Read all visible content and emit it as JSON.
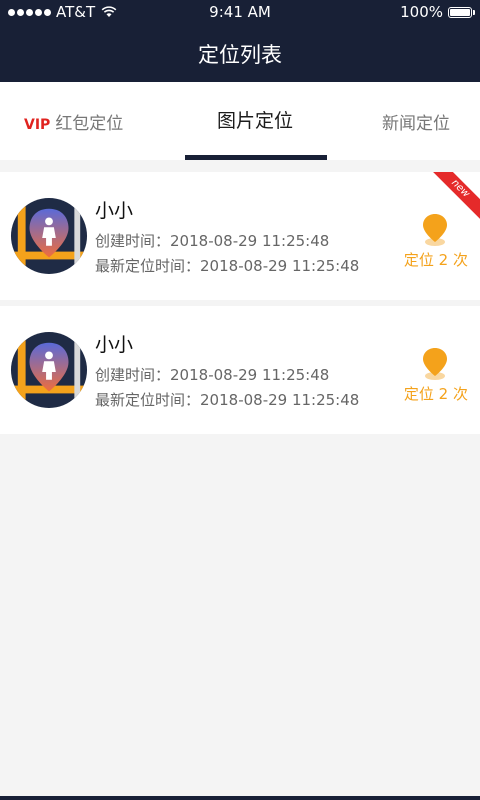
{
  "status_bar": {
    "carrier": "AT&T",
    "time": "9:41 AM",
    "battery": "100%",
    "battery_level": 1.0
  },
  "header": {
    "title": "定位列表"
  },
  "tabs": [
    {
      "badge": "VIP",
      "label": "红包定位",
      "active": false
    },
    {
      "label": "图片定位",
      "active": true
    },
    {
      "label": "新闻定位",
      "active": false
    }
  ],
  "items": [
    {
      "name": "小小",
      "created_label": "创建时间：",
      "created": "2018-08-29  11:25:48",
      "latest_label": "最新定位时间：",
      "latest": "2018-08-29  11:25:48",
      "count_text": "定位 2 次",
      "badge": "new"
    },
    {
      "name": "小小",
      "created_label": "创建时间：",
      "created": "2018-08-29  11:25:48",
      "latest_label": "最新定位时间：",
      "latest": "2018-08-29  11:25:48",
      "count_text": "定位 2 次"
    }
  ],
  "colors": {
    "nav_bg": "#182036",
    "accent": "#f4a21b",
    "vip_red": "#e0231f"
  },
  "icons": {
    "avatar": "location-person-avatar",
    "pin": "location-pin-icon",
    "wifi": "wifi-icon",
    "battery": "battery-icon"
  }
}
